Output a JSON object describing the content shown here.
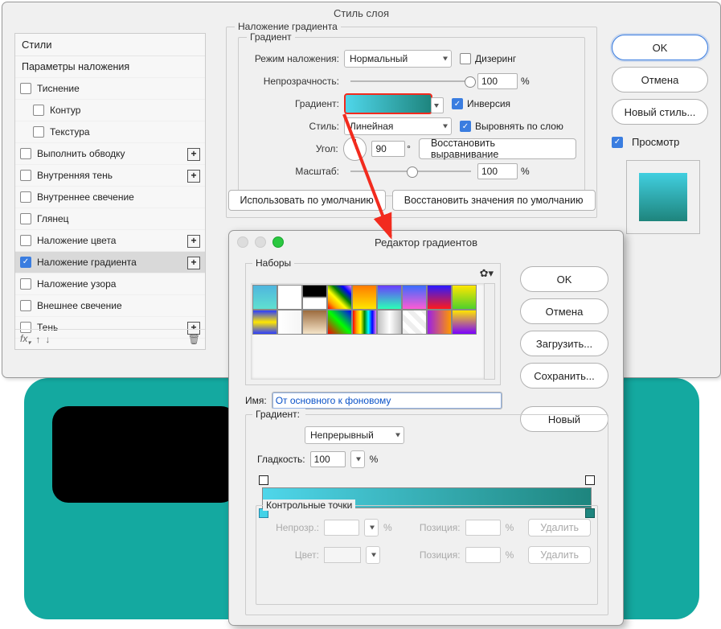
{
  "win1": {
    "title": "Стиль слоя",
    "styles_header": "Стили",
    "params_header": "Параметры наложения",
    "rows": [
      {
        "label": "Тиснение",
        "indent": false,
        "plus": false,
        "checked": false
      },
      {
        "label": "Контур",
        "indent": true,
        "plus": false,
        "checked": false
      },
      {
        "label": "Текстура",
        "indent": true,
        "plus": false,
        "checked": false
      },
      {
        "label": "Выполнить обводку",
        "indent": false,
        "plus": true,
        "checked": false
      },
      {
        "label": "Внутренняя тень",
        "indent": false,
        "plus": true,
        "checked": false
      },
      {
        "label": "Внутреннее свечение",
        "indent": false,
        "plus": false,
        "checked": false
      },
      {
        "label": "Глянец",
        "indent": false,
        "plus": false,
        "checked": false
      },
      {
        "label": "Наложение цвета",
        "indent": false,
        "plus": true,
        "checked": false
      },
      {
        "label": "Наложение градиента",
        "indent": false,
        "plus": true,
        "checked": true,
        "selected": true
      },
      {
        "label": "Наложение узора",
        "indent": false,
        "plus": false,
        "checked": false
      },
      {
        "label": "Внешнее свечение",
        "indent": false,
        "plus": false,
        "checked": false
      },
      {
        "label": "Тень",
        "indent": false,
        "plus": true,
        "checked": false
      }
    ],
    "fx_label": "fx",
    "grad_overlay": {
      "group": "Наложение градиента",
      "sub": "Градиент",
      "blend_mode_label": "Режим наложения:",
      "blend_mode": "Нормальный",
      "dither": "Дизеринг",
      "opacity_label": "Непрозрачность:",
      "opacity": "100",
      "opacity_unit": "%",
      "grad_label": "Градиент:",
      "reverse": "Инверсия",
      "style_label": "Стиль:",
      "style": "Линейная",
      "align": "Выровнять по слою",
      "angle_label": "Угол:",
      "angle": "90",
      "angle_unit": "°",
      "reset_align": "Восстановить выравнивание",
      "scale_label": "Масштаб:",
      "scale": "100",
      "scale_unit": "%",
      "make_default": "Использовать по умолчанию",
      "reset_default": "Восстановить значения по умолчанию"
    },
    "right": {
      "ok": "OK",
      "cancel": "Отмена",
      "new_style": "Новый стиль...",
      "preview": "Просмотр"
    }
  },
  "win2": {
    "title": "Редактор градиентов",
    "presets": "Наборы",
    "ok": "OK",
    "cancel": "Отмена",
    "load": "Загрузить...",
    "save": "Сохранить...",
    "new": "Новый",
    "name_label": "Имя:",
    "name_value": "От основного к фоновому",
    "grad_group": "Градиент:",
    "grad_type": "Непрерывный",
    "smooth_label": "Гладкость:",
    "smooth": "100",
    "smooth_unit": "%",
    "cp_group": "Контрольные точки",
    "opacity_label": "Непрозр.:",
    "opacity_unit": "%",
    "pos_label": "Позиция:",
    "pos_unit": "%",
    "del": "Удалить",
    "color_label": "Цвет:"
  }
}
